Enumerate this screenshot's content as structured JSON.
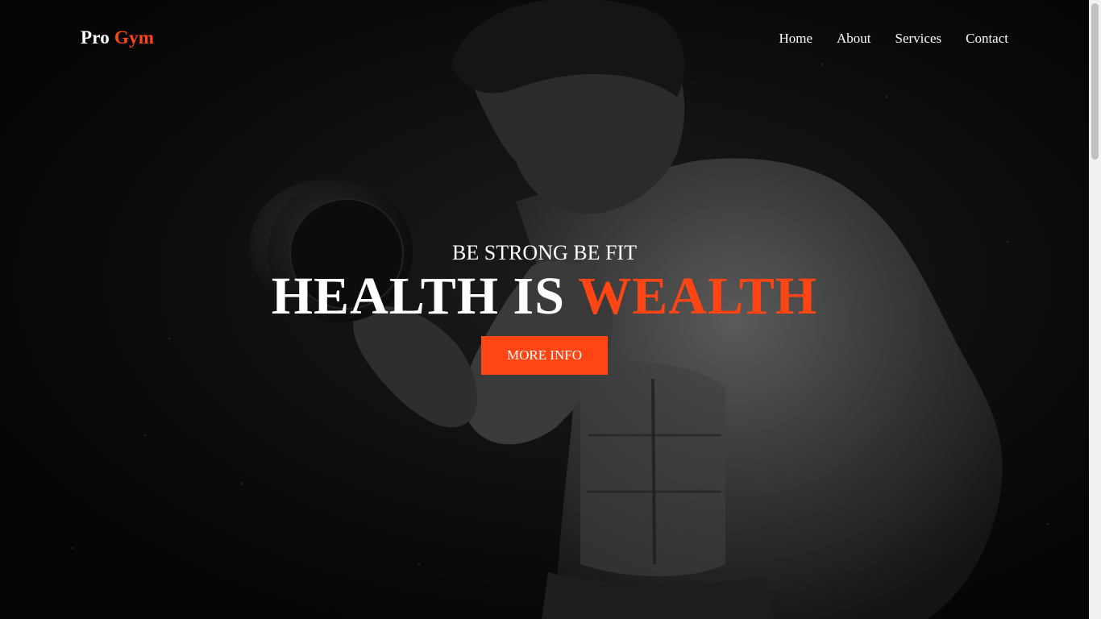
{
  "brand": {
    "name_part1": "Pro",
    "name_part2": "Gym"
  },
  "nav": {
    "items": [
      {
        "label": "Home"
      },
      {
        "label": "About"
      },
      {
        "label": "Services"
      },
      {
        "label": "Contact"
      }
    ]
  },
  "hero": {
    "subtitle": "BE STRONG BE FIT",
    "title_part1": "HEALTH IS",
    "title_part2": "WEALTH",
    "button_label": "MORE INFO"
  },
  "colors": {
    "accent": "#ff4514",
    "background": "#000000",
    "text": "#ffffff"
  }
}
